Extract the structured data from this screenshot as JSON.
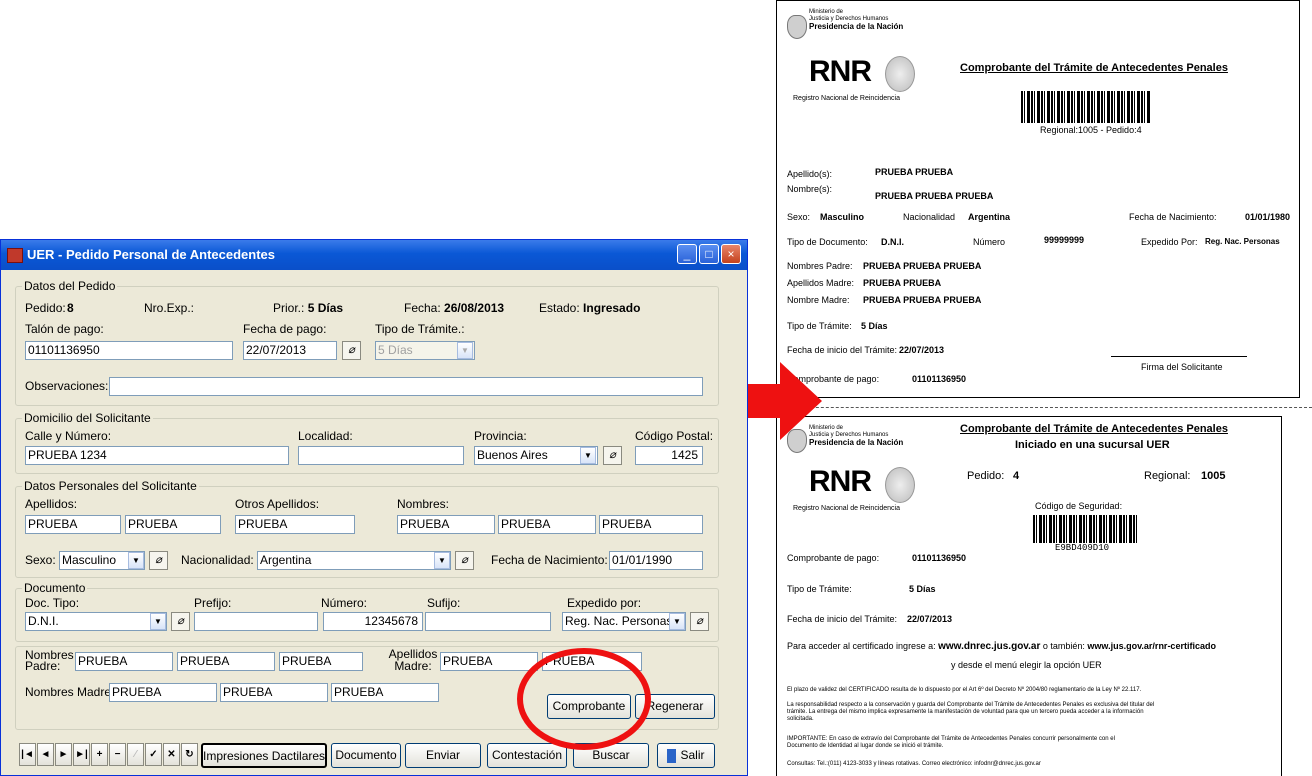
{
  "window": {
    "title": "UER - Pedido Personal de Antecedentes",
    "minimize": "_",
    "maximize": "□",
    "close": "×"
  },
  "datos_pedido": {
    "legend": "Datos del Pedido",
    "pedido_label": "Pedido:",
    "pedido_value": "8",
    "nro_exp_label": "Nro.Exp.:",
    "prior_label": "Prior.:",
    "prior_value": "5 Días",
    "fecha_label": "Fecha:",
    "fecha_value": "26/08/2013",
    "estado_label": "Estado:",
    "estado_value": "Ingresado",
    "talon_label": "Talón de pago:",
    "talon_value": "01101136950",
    "fecha_pago_label": "Fecha de pago:",
    "fecha_pago_value": "22/07/2013",
    "tipo_tramite_label": "Tipo de Trámite.:",
    "tipo_tramite_value": "5 Días",
    "observaciones_label": "Observaciones:",
    "observaciones_value": ""
  },
  "domicilio": {
    "legend": "Domicilio del Solicitante",
    "calle_label": "Calle y Número:",
    "calle_value": "PRUEBA 1234",
    "localidad_label": "Localidad:",
    "localidad_value": "",
    "provincia_label": "Provincia:",
    "provincia_value": "Buenos Aires",
    "cp_label": "Código Postal:",
    "cp_value": "1425"
  },
  "personales": {
    "legend": "Datos Personales del Solicitante",
    "apellidos_label": "Apellidos:",
    "apellido1": "PRUEBA",
    "apellido2": "PRUEBA",
    "otros_label": "Otros Apellidos:",
    "otros_value": "PRUEBA",
    "nombres_label": "Nombres:",
    "nombre1": "PRUEBA",
    "nombre2": "PRUEBA",
    "nombre3": "PRUEBA",
    "sexo_label": "Sexo:",
    "sexo_value": "Masculino",
    "nacionalidad_label": "Nacionalidad:",
    "nacionalidad_value": "Argentina",
    "fnac_label": "Fecha de Nacimiento:",
    "fnac_value": "01/01/1990"
  },
  "documento": {
    "legend": "Documento",
    "tipo_label": "Doc. Tipo:",
    "tipo_value": "D.N.I.",
    "prefijo_label": "Prefijo:",
    "prefijo_value": "",
    "numero_label": "Número:",
    "numero_value": "12345678",
    "sufijo_label": "Sufijo:",
    "sufijo_value": "",
    "expedido_label": "Expedido por:",
    "expedido_value": "Reg. Nac. Personas"
  },
  "padres": {
    "nombres_padre_label": "Nombres Padre:",
    "padre1": "PRUEBA",
    "padre2": "PRUEBA",
    "padre3": "PRUEBA",
    "apellidos_madre_label": "Apellidos Madre:",
    "amadre1": "PRUEBA",
    "amadre2": "PRUEBA",
    "nombres_madre_label": "Nombres Madre:",
    "nmadre1": "PRUEBA",
    "nmadre2": "PRUEBA",
    "nmadre3": "PRUEBA"
  },
  "buttons": {
    "comprobante": "Comprobante",
    "regenerar": "Regenerar",
    "impresiones": "Impresiones Dactilares",
    "documento": "Documento",
    "enviar": "Enviar",
    "contestacion": "Contestación",
    "buscar": "Buscar",
    "salir": "Salir"
  },
  "nav": {
    "first": "|◄",
    "prev": "◄",
    "next": "►",
    "last": "►|",
    "add": "+",
    "del": "−",
    "edit": "⁄",
    "post": "✓",
    "cancel": "✕",
    "refresh": "↻"
  },
  "doc1": {
    "ministerio": "Ministerio de",
    "justicia": "Justicia y Derechos Humanos",
    "presidencia": "Presidencia de la Nación",
    "rnr": "RNR",
    "rnr_sub": "Registro Nacional de Reincidencia",
    "title": "Comprobante del Trámite de Antecedentes Penales",
    "regional": "Regional:1005 - Pedido:4",
    "apellidos_label": "Apellido(s):",
    "apellidos_value": "PRUEBA PRUEBA",
    "nombres_label": "Nombre(s):",
    "nombres_value": "PRUEBA PRUEBA PRUEBA",
    "sexo_label": "Sexo:",
    "sexo_value": "Masculino",
    "nacionalidad_label": "Nacionalidad",
    "nacionalidad_value": "Argentina",
    "fnac_label": "Fecha de Nacimiento:",
    "fnac_value": "01/01/1980",
    "tipodoc_label": "Tipo de Documento:",
    "tipodoc_value": "D.N.I.",
    "numero_label": "Número",
    "numero_value": "99999999",
    "expedido_label": "Expedido Por:",
    "expedido_value": "Reg. Nac. Personas",
    "npadre_label": "Nombres Padre:",
    "npadre_value": "PRUEBA PRUEBA PRUEBA",
    "amadre_label": "Apellidos Madre:",
    "amadre_value": "PRUEBA PRUEBA",
    "nmadre_label": "Nombre Madre:",
    "nmadre_value": "PRUEBA PRUEBA PRUEBA",
    "tipotramite_label": "Tipo de Trámite:",
    "tipotramite_value": "5 Días",
    "finicio_label": "Fecha de inicio del Trámite:",
    "finicio_value": "22/07/2013",
    "firma": "Firma del Solicitante",
    "comprobante_label": "Comprobante de pago:",
    "comprobante_value": "01101136950"
  },
  "doc2": {
    "ministerio": "Ministerio de",
    "justicia": "Justicia y Derechos Humanos",
    "presidencia": "Presidencia de la Nación",
    "rnr": "RNR",
    "rnr_sub": "Registro Nacional de Reincidencia",
    "title": "Comprobante del Trámite de Antecedentes Penales",
    "subtitle": "Iniciado en una sucursal UER",
    "pedido_label": "Pedido:",
    "pedido_value": "4",
    "regional_label": "Regional:",
    "regional_value": "1005",
    "codigo_label": "Código de Seguridad:",
    "codigo_value": "E9BD409D10",
    "comprobante_label": "Comprobante de pago:",
    "comprobante_value": "01101136950",
    "tipotramite_label": "Tipo de Trámite:",
    "tipotramite_value": "5 Días",
    "finicio_label": "Fecha de inicio del Trámite:",
    "finicio_value": "22/07/2013",
    "acceder_pre": "Para acceder al certificado ingrese a:",
    "url1": "www.dnrec.jus.gov.ar",
    "tambien": "o también:",
    "url2": "www.jus.gov.ar/rnr-certificado",
    "menu": "y desde el menú elegir la opción UER",
    "p1": "El plazo de validez del CERTIFICADO resulta de lo dispuesto por el Art 6º del Decreto Nº 2004/80 reglamentario de la Ley Nº 22.117.",
    "p2a": "La responsabilidad respecto a la conservación y guarda del Comprobante del Trámite de Antecedentes Penales es exclusiva del titular del",
    "p2b": "trámite. La entrega del mismo implica expresamente la manifestación de voluntad para que un tercero pueda acceder a la información",
    "p2c": "solicitada.",
    "p3a": "IMPORTANTE: En caso de extravío del Comprobante del Trámite de Antecedentes Penales concurrir personalmente con el",
    "p3b": "Documento de Identidad al lugar donde se inició el trámite.",
    "p4": "Consultas: Tel.:(011) 4123-3033 y líneas rotativas. Correo electrónico: infodnr@dnrec.jus.gov.ar"
  },
  "colors": {
    "arrow": "#ee1111",
    "circle": "#ee1111",
    "titlebar": "#0A58D6"
  }
}
